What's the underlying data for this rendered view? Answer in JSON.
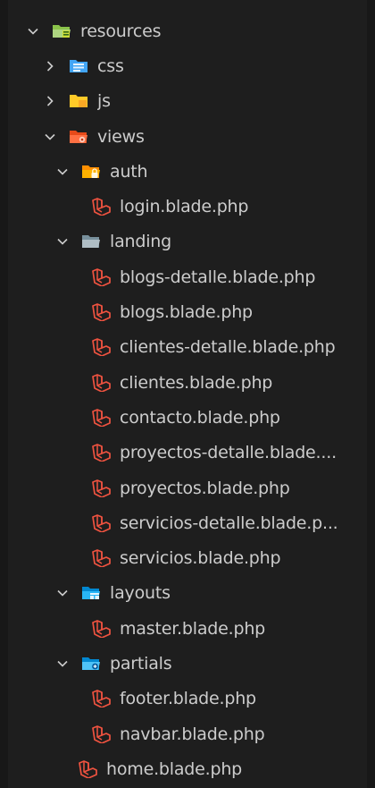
{
  "explorer": {
    "root": {
      "label": "resources",
      "state": "expanded",
      "icon": "folder-resources-open-icon"
    },
    "css": {
      "label": "css",
      "state": "collapsed",
      "icon": "folder-css-icon"
    },
    "js": {
      "label": "js",
      "state": "collapsed",
      "icon": "folder-js-icon"
    },
    "views": {
      "label": "views",
      "state": "expanded",
      "icon": "folder-views-open-icon"
    },
    "auth": {
      "label": "auth",
      "state": "expanded",
      "icon": "folder-auth-open-icon",
      "files": [
        "login.blade.php"
      ]
    },
    "landing": {
      "label": "landing",
      "state": "expanded",
      "icon": "folder-open-icon",
      "files": [
        "blogs-detalle.blade.php",
        "blogs.blade.php",
        "clientes-detalle.blade.php",
        "clientes.blade.php",
        "contacto.blade.php",
        "proyectos-detalle.blade....",
        "proyectos.blade.php",
        "servicios-detalle.blade.p...",
        "servicios.blade.php"
      ]
    },
    "layouts": {
      "label": "layouts",
      "state": "expanded",
      "icon": "folder-layouts-open-icon",
      "files": [
        "master.blade.php"
      ]
    },
    "partials": {
      "label": "partials",
      "state": "expanded",
      "icon": "folder-partials-open-icon",
      "files": [
        "footer.blade.php",
        "navbar.blade.php"
      ]
    },
    "view_files": [
      "home.blade.php"
    ],
    "file_icon": "laravel-blade-icon"
  },
  "colors": {
    "background": "#1e1e1e",
    "text": "#cccccc",
    "blade_icon": "#f05340",
    "css_folder": "#42a5f5",
    "js_folder": "#ffca28",
    "views_folder": "#ff7043",
    "auth_folder": "#ffb300",
    "landing_folder": "#90a4ae",
    "layouts_folder": "#29b6f6",
    "partials_folder": "#29b6f6"
  }
}
